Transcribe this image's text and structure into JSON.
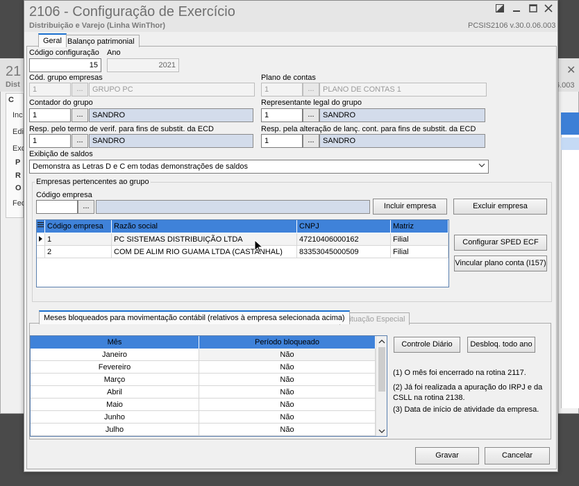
{
  "background_window": {
    "title": "21",
    "subtitle": "Dist",
    "close_glyph": "✕",
    "version_fragment": "6.003",
    "items": [
      "C",
      "Inc",
      "Edi",
      "Exc",
      "P",
      "R",
      "O",
      "Fec"
    ]
  },
  "window": {
    "title": "2106 - Configuração de Exercício",
    "subtitle": "Distribuição e Varejo (Linha WinThor)",
    "version": "PCSIS2106  v.30.0.06.003",
    "icons": [
      "restore-icon",
      "minimize-icon",
      "maximize-icon",
      "close-icon"
    ]
  },
  "tabs": {
    "geral": "Geral",
    "balanco": "Balanço patrimonial"
  },
  "form": {
    "codigo_config_label": "Código configuração",
    "codigo_config_value": "15",
    "ano_label": "Ano",
    "ano_value": "2021",
    "grupo_label": "Cód. grupo empresas",
    "grupo_code": "1",
    "grupo_name": "GRUPO PC",
    "plano_label": "Plano de contas",
    "plano_code": "1",
    "plano_name": "PLANO DE CONTAS 1",
    "contador_label": "Contador do grupo",
    "contador_code": "1",
    "contador_name": "SANDRO",
    "representante_label": "Representante legal do grupo",
    "representante_code": "1",
    "representante_name": "SANDRO",
    "resp_termo_label": "Resp. pelo termo de verif. para fins de substit. da ECD",
    "resp_termo_code": "1",
    "resp_termo_name": "SANDRO",
    "resp_alt_label": "Resp. pela alteração de lanç. cont. para fins de substit. da ECD",
    "resp_alt_code": "1",
    "resp_alt_name": "SANDRO",
    "exibicao_label": "Exibição de saldos",
    "exibicao_value": "Demonstra as Letras D e C em todas demonstrações de saldos",
    "ellipsis": "..."
  },
  "empresas": {
    "group_title": "Empresas pertencentes ao grupo",
    "codigo_label": "Código empresa",
    "codigo_value": "",
    "incluir": "Incluir empresa",
    "excluir": "Excluir empresa",
    "configurar_sped": "Configurar SPED ECF",
    "vincular": "Vincular plano conta (I157)",
    "columns": [
      "Código empresa",
      "Razão social",
      "CNPJ",
      "Matriz"
    ],
    "rows": [
      {
        "codigo": "1",
        "razao": "PC SISTEMAS DISTRIBUIÇÃO LTDA",
        "cnpj": "47210406000162",
        "matriz": "Filial"
      },
      {
        "codigo": "2",
        "razao": "COM DE ALIM RIO GUAMA LTDA (CASTANHAL)",
        "cnpj": "83353045000509",
        "matriz": "Filial"
      }
    ]
  },
  "bottom_tabs": {
    "meses": "Meses bloqueados para movimentação contábil (relativos à empresa selecionada acima)",
    "situacao": "Situação Especial"
  },
  "meses": {
    "columns": [
      "Mês",
      "Período bloqueado"
    ],
    "rows": [
      {
        "mes": "Janeiro",
        "bloq": "Não"
      },
      {
        "mes": "Fevereiro",
        "bloq": "Não"
      },
      {
        "mes": "Março",
        "bloq": "Não"
      },
      {
        "mes": "Abril",
        "bloq": "Não"
      },
      {
        "mes": "Maio",
        "bloq": "Não"
      },
      {
        "mes": "Junho",
        "bloq": "Não"
      },
      {
        "mes": "Julho",
        "bloq": "Não"
      }
    ],
    "controle_diario": "Controle Diário",
    "desbloq": "Desbloq. todo ano",
    "notes": [
      "(1)  O mês foi encerrado na rotina 2117.",
      "(2)  Já foi realizada a apuração do IRPJ e da CSLL na rotina 2138.",
      "(3)  Data de início de atividade da empresa."
    ]
  },
  "footer": {
    "gravar": "Gravar",
    "cancelar": "Cancelar"
  }
}
